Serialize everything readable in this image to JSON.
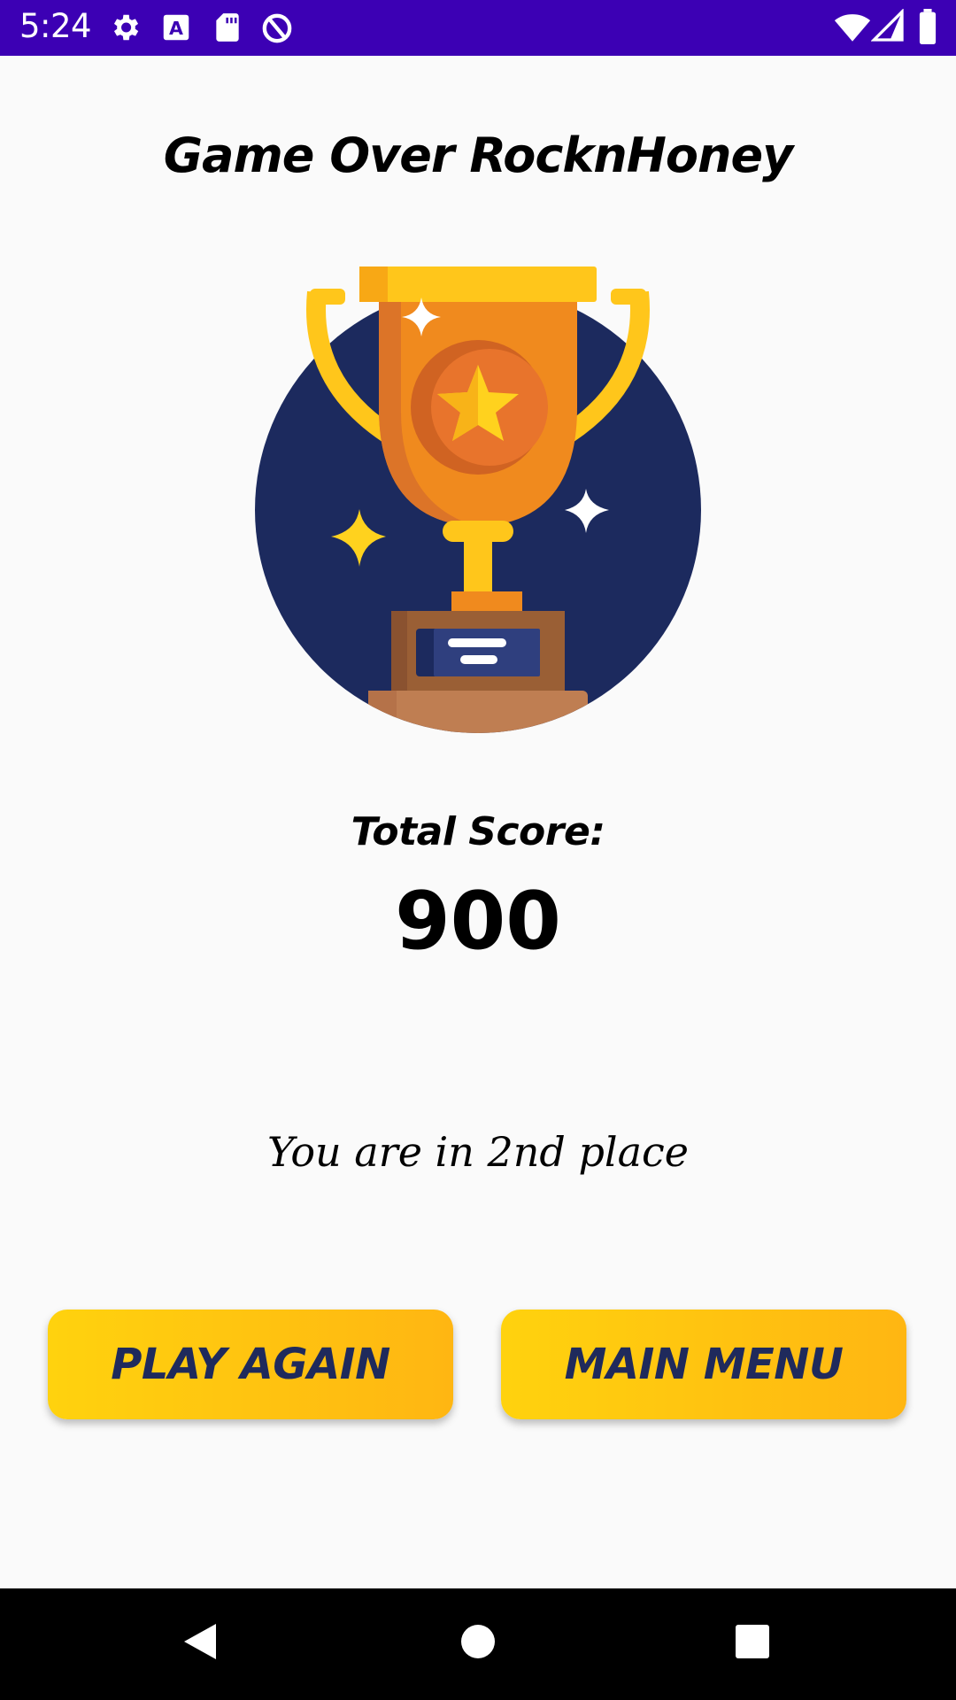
{
  "status_bar": {
    "time": "5:24",
    "icons_left": [
      "settings-icon",
      "keyboard-a-icon",
      "sd-card-icon",
      "data-saver-icon"
    ],
    "icons_right": [
      "wifi-icon",
      "cellular-signal-icon",
      "battery-icon"
    ],
    "background": "#3c00b4"
  },
  "title": "Game Over RocknHoney",
  "trophy": {
    "icon": "trophy-illustration",
    "circle_color": "#1c2a5e",
    "cup_color": "#f08a1e"
  },
  "score": {
    "label": "Total Score:",
    "value": "900"
  },
  "place_text": "You are in 2nd place",
  "buttons": {
    "play_again": "PLAY AGAIN",
    "main_menu": "MAIN MENU",
    "color_start": "#ffd20e",
    "color_end": "#ffb612",
    "text_color": "#1f2a5c"
  },
  "nav_bar": {
    "buttons": [
      "back-icon",
      "home-icon",
      "recents-icon"
    ]
  }
}
